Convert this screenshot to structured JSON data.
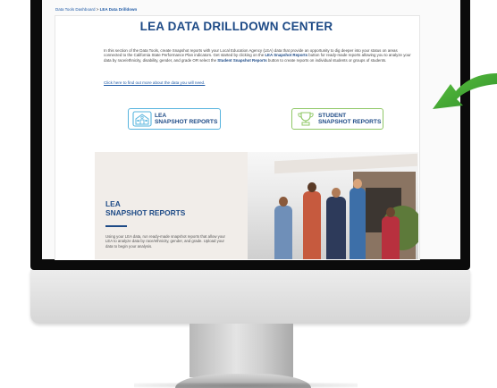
{
  "breadcrumb": {
    "home": "Data Tools Dashboard",
    "separator": ">",
    "current": "LEA Data Drilldown"
  },
  "page": {
    "title": "LEA DATA DRILLDOWN CENTER",
    "intro_before_lea": "In this section of the Data Tools, create Snapshot reports with your Local Education Agency (LEA) data that provide an opportunity to dig deeper into your status on areas connected to the California State Performance Plan indicators. Get started by clicking on the",
    "intro_lea_button": "LEA Snapshot Reports",
    "intro_middle": "button for ready-made reports allowing you to analyze your data by race/ethnicity, disability, gender, and grade OR select the",
    "intro_student_button": "Student Snapshot Reports",
    "intro_after": "button to create reports on individual students or groups of students.",
    "more_link": "Click here to find out more about the data you will need."
  },
  "buttons": {
    "lea": {
      "line1": "LEA",
      "line2": "SNAPSHOT REPORTS",
      "icon": "school-building-icon"
    },
    "student": {
      "line1": "STUDENT",
      "line2": "SNAPSHOT REPORTS",
      "icon": "student-trophy-icon"
    }
  },
  "card": {
    "title_line1": "LEA",
    "title_line2": "SNAPSHOT REPORTS",
    "text": "Using your LEA data, run ready-made snapshot reports that allow your LEA to analyze data by race/ethnicity, gender, and grade. Upload your data to begin your analysis."
  },
  "colors": {
    "title_blue": "#1d4a86",
    "link_blue": "#1f5aa6",
    "lea_button_border": "#57b4de",
    "student_button_border": "#8fc766",
    "arrow_green": "#3aa935",
    "card_bg": "#f1ede9"
  }
}
